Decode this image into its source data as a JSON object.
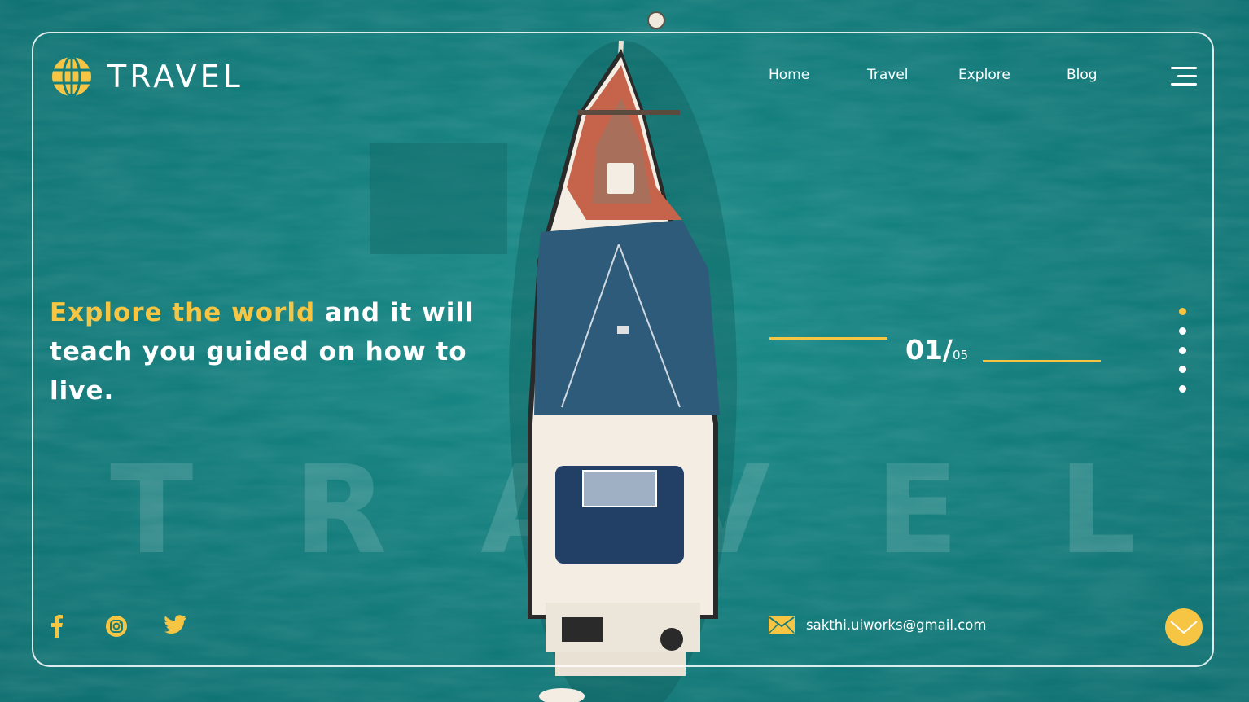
{
  "brand": {
    "name": "TRAVEL",
    "accent": "#f7c544"
  },
  "nav": {
    "items": [
      {
        "label": "Home"
      },
      {
        "label": "Travel"
      },
      {
        "label": "Explore"
      },
      {
        "label": "Blog"
      }
    ]
  },
  "hero": {
    "headline_highlight": "Explore the world",
    "headline_rest": " and it will teach you guided on how to live."
  },
  "slider": {
    "current": "01/",
    "total": "05",
    "active_dot": 1,
    "dot_count": 5
  },
  "watermark": {
    "letters": [
      "T",
      "R",
      "A",
      "V",
      "E",
      "L"
    ]
  },
  "social": [
    {
      "icon": "facebook-icon"
    },
    {
      "icon": "instagram-icon"
    },
    {
      "icon": "twitter-icon"
    }
  ],
  "contact": {
    "email": "sakthi.uiworks@gmail.com",
    "icon": "mail-icon"
  },
  "scroll": {
    "icon": "chevron-down-icon"
  },
  "colors": {
    "sea": "#137e7d",
    "accent": "#f7c544",
    "text": "#ffffff"
  }
}
